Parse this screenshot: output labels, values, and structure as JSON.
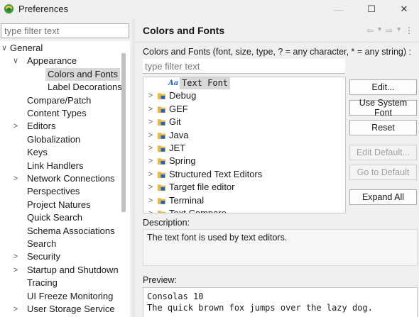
{
  "window": {
    "title": "Preferences",
    "minimize": "—",
    "maximize": "☐",
    "close": "✕"
  },
  "left": {
    "filter_placeholder": "type filter text",
    "tree": [
      {
        "label": "General",
        "arrow": "∨",
        "level": 0
      },
      {
        "label": "Appearance",
        "arrow": "∨",
        "level": 1
      },
      {
        "label": "Colors and Fonts",
        "arrow": "",
        "level": 2,
        "selected": true
      },
      {
        "label": "Label Decorations",
        "arrow": "",
        "level": 2
      },
      {
        "label": "Compare/Patch",
        "arrow": "",
        "level": 1
      },
      {
        "label": "Content Types",
        "arrow": "",
        "level": 1
      },
      {
        "label": "Editors",
        "arrow": ">",
        "level": 1
      },
      {
        "label": "Globalization",
        "arrow": "",
        "level": 1
      },
      {
        "label": "Keys",
        "arrow": "",
        "level": 1
      },
      {
        "label": "Link Handlers",
        "arrow": "",
        "level": 1
      },
      {
        "label": "Network Connections",
        "arrow": ">",
        "level": 1
      },
      {
        "label": "Perspectives",
        "arrow": "",
        "level": 1
      },
      {
        "label": "Project Natures",
        "arrow": "",
        "level": 1
      },
      {
        "label": "Quick Search",
        "arrow": "",
        "level": 1
      },
      {
        "label": "Schema Associations",
        "arrow": "",
        "level": 1
      },
      {
        "label": "Search",
        "arrow": "",
        "level": 1
      },
      {
        "label": "Security",
        "arrow": ">",
        "level": 1
      },
      {
        "label": "Startup and Shutdown",
        "arrow": ">",
        "level": 1
      },
      {
        "label": "Tracing",
        "arrow": "",
        "level": 1
      },
      {
        "label": "UI Freeze Monitoring",
        "arrow": "",
        "level": 1
      },
      {
        "label": "User Storage Service",
        "arrow": ">",
        "level": 1
      }
    ]
  },
  "right": {
    "title": "Colors and Fonts",
    "description": "Colors and Fonts (font, size, type, ? = any character, * = any string) :",
    "filter_placeholder": "type filter text",
    "items": [
      {
        "label": "Text Font",
        "selected": true,
        "icon": "font-icon",
        "icon_text": "Aa"
      },
      {
        "label": "Debug",
        "arrow": ">",
        "icon": "category-icon"
      },
      {
        "label": "GEF",
        "arrow": ">",
        "icon": "category-icon"
      },
      {
        "label": "Git",
        "arrow": ">",
        "icon": "category-icon"
      },
      {
        "label": "Java",
        "arrow": ">",
        "icon": "category-icon"
      },
      {
        "label": "JET",
        "arrow": ">",
        "icon": "category-icon"
      },
      {
        "label": "Spring",
        "arrow": ">",
        "icon": "category-icon"
      },
      {
        "label": "Structured Text Editors",
        "arrow": ">",
        "icon": "category-icon"
      },
      {
        "label": "Target file editor",
        "arrow": ">",
        "icon": "category-icon"
      },
      {
        "label": "Terminal",
        "arrow": ">",
        "icon": "category-icon"
      },
      {
        "label": "Text Compare",
        "arrow": ">",
        "icon": "category-icon"
      }
    ],
    "buttons": {
      "edit": "Edit...",
      "use_system_font": "Use System Font",
      "reset": "Reset",
      "edit_default": "Edit Default...",
      "go_to_default": "Go to Default",
      "expand_all": "Expand All"
    },
    "description_label": "Description:",
    "description_text": "The text font is used by text editors.",
    "preview_label": "Preview:",
    "preview_line1": "Consolas 10",
    "preview_line2": "The quick brown fox jumps over the lazy dog."
  },
  "colors": {
    "accent": "#1c64c8",
    "folder": "#e8b84a",
    "selection": "#d8d8d8"
  }
}
